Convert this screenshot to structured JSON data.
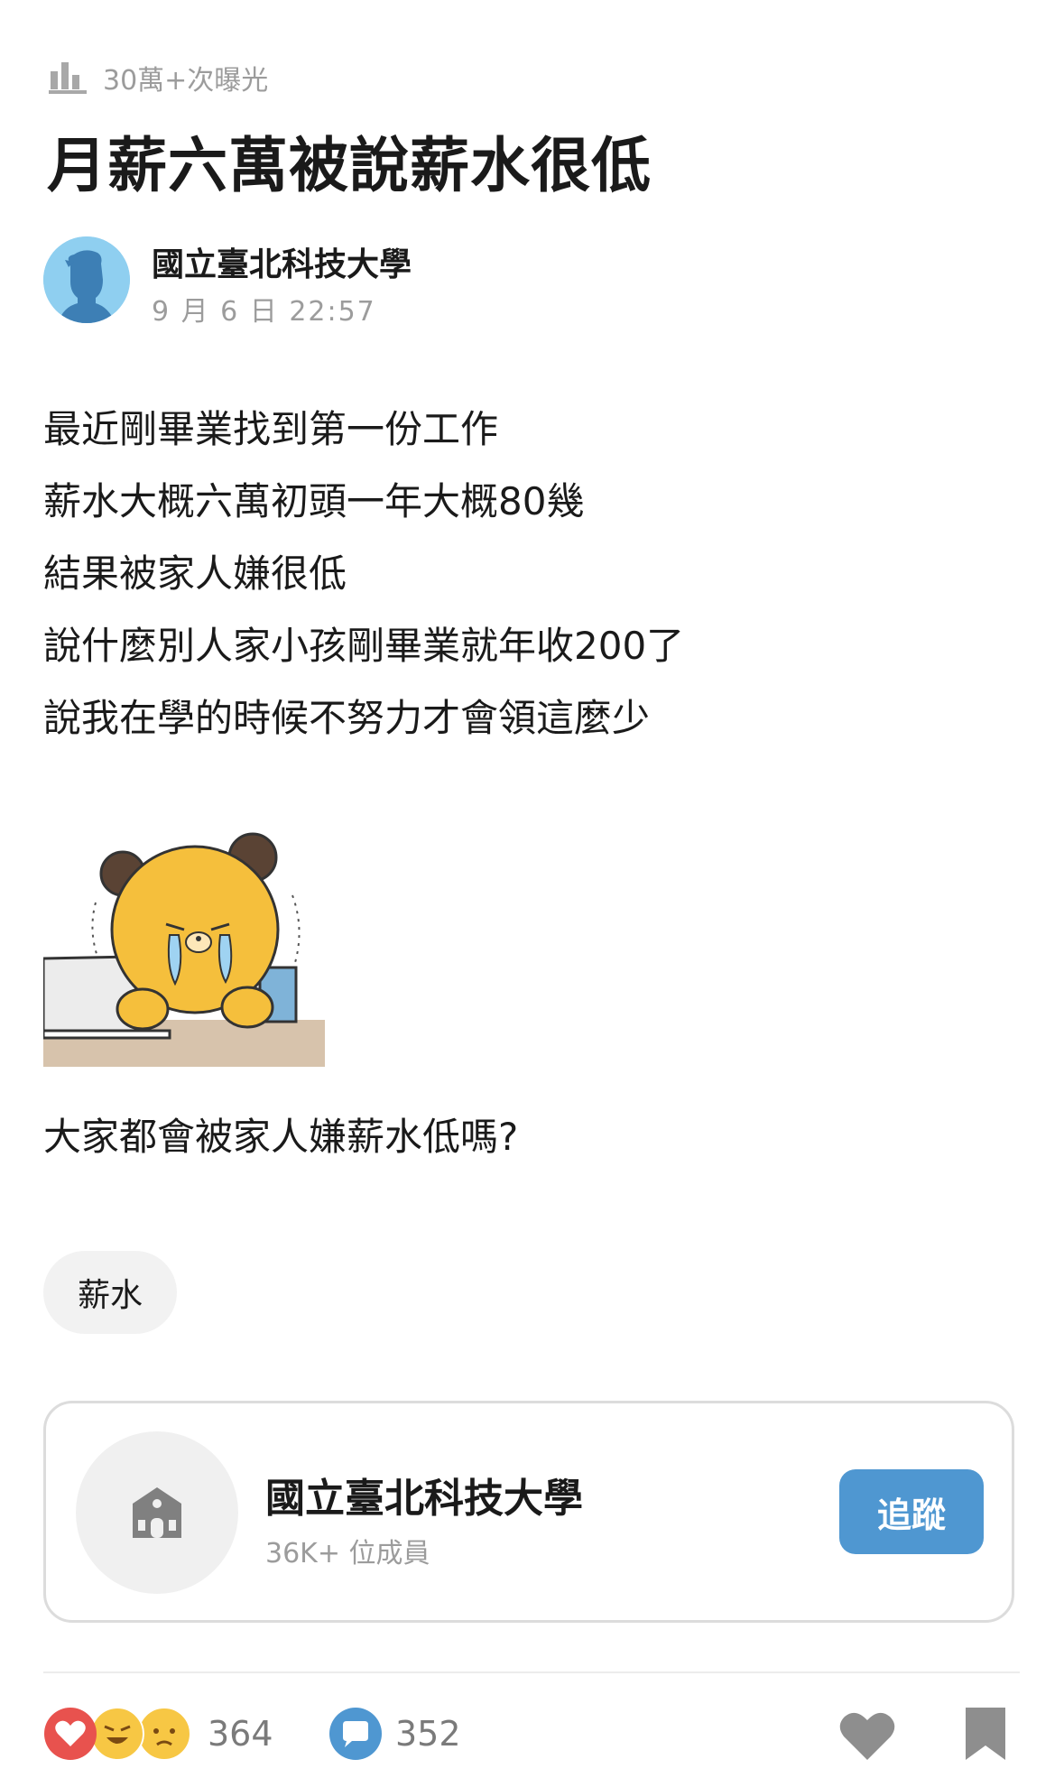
{
  "post": {
    "views": "30萬+次曝光",
    "title": "月薪六萬被說薪水很低",
    "author": "國立臺北科技大學",
    "date": "9 月 6 日 22:57",
    "body": [
      "最近剛畢業找到第一份工作",
      "薪水大概六萬初頭一年大概80幾",
      "結果被家人嫌很低",
      "說什麼別人家小孩剛畢業就年收200了",
      "說我在學的時候不努力才會領這麼少"
    ],
    "question": "大家都會被家人嫌薪水低嗎?",
    "topic": "薪水"
  },
  "board": {
    "name": "國立臺北科技大學",
    "members": "36K+ 位成員",
    "follow_label": "追蹤"
  },
  "stats": {
    "reactions": "364",
    "comments": "352"
  },
  "icons": {
    "views": "bar-chart-icon",
    "author_avatar": "person-silhouette-avatar",
    "board_avatar": "school-building-icon",
    "reactions": [
      "heart-reaction-icon",
      "laugh-reaction-icon",
      "sad-reaction-icon"
    ],
    "comment": "speech-bubble-icon",
    "like": "heart-icon",
    "bookmark": "bookmark-icon"
  },
  "colors": {
    "accent": "#4f97d1",
    "heart": "#e8524e",
    "muted_text": "#9c9c9c",
    "sticker_bear": "#f5bf3c"
  }
}
